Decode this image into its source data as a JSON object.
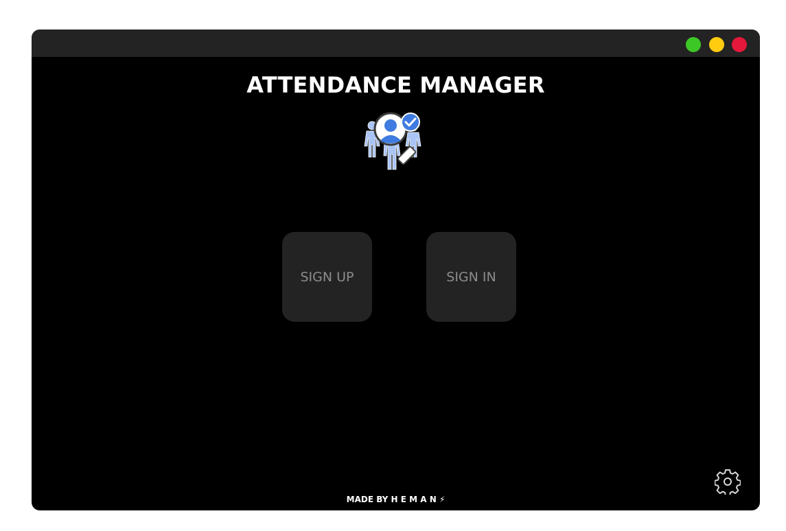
{
  "window": {
    "controls": [
      {
        "name": "maximize",
        "color": "#3dc727"
      },
      {
        "name": "minimize",
        "color": "#ffcc0f"
      },
      {
        "name": "close",
        "color": "#e3183a"
      }
    ]
  },
  "header": {
    "title": "ATTENDANCE MANAGER",
    "logo_icon": "attendance-people-search-icon"
  },
  "actions": {
    "signup_label": "SIGN UP",
    "signin_label": "SIGN IN"
  },
  "settings": {
    "icon": "gear-icon"
  },
  "footer": {
    "credit": "MADE BY H E M A N ⚡"
  },
  "colors": {
    "background": "#000000",
    "titlebar": "#232323",
    "button_bg": "#232323",
    "button_text": "#8c8c8c",
    "logo_people": "#a9c4f5",
    "logo_accent": "#3f7be0"
  }
}
